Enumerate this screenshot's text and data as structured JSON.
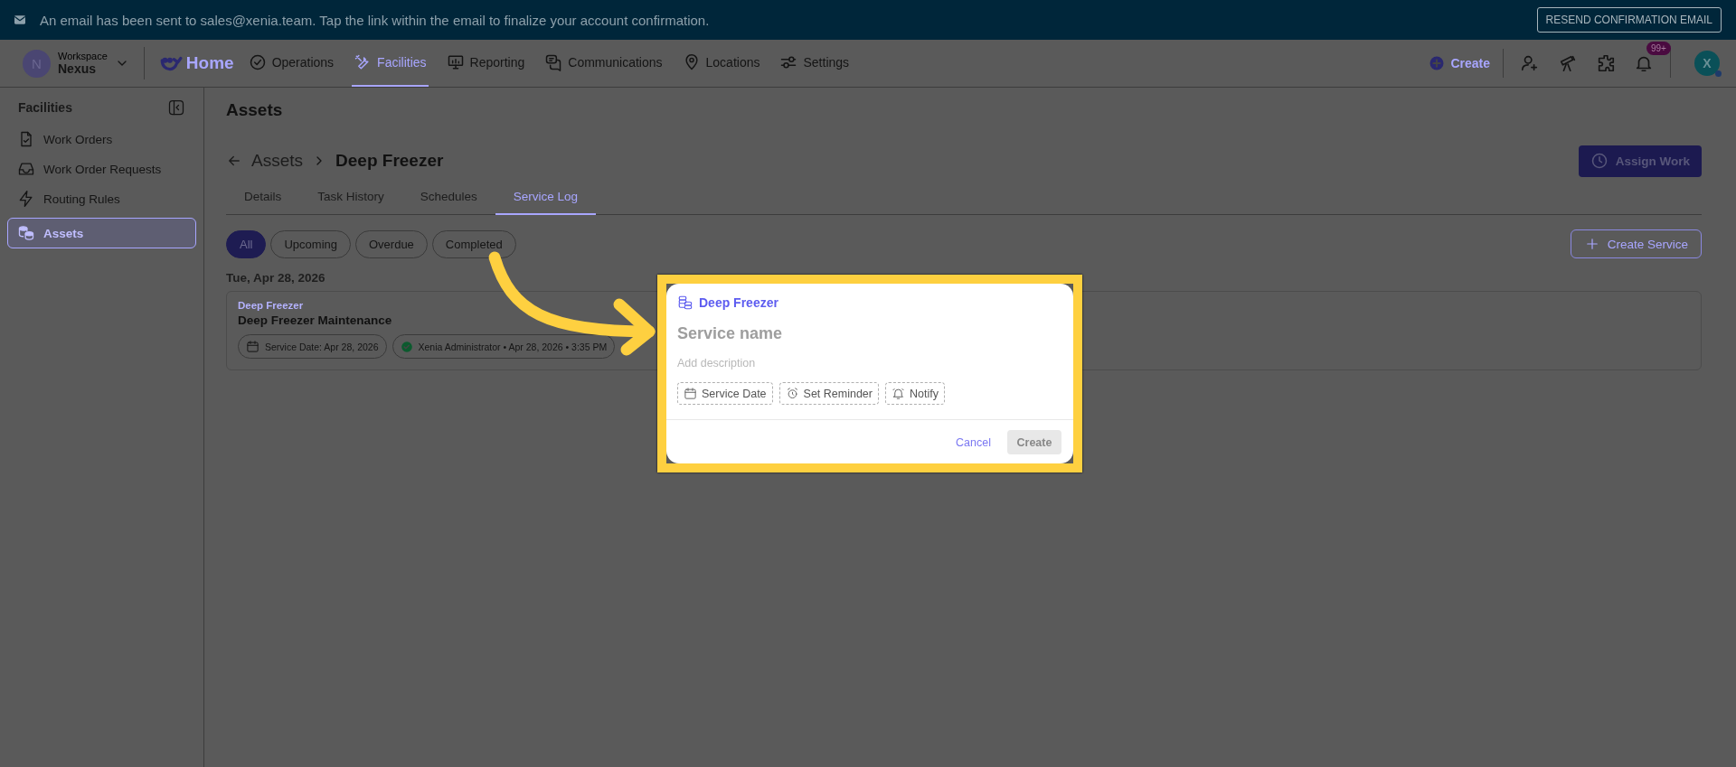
{
  "banner": {
    "message": "An email has been sent to sales@xenia.team. Tap the link within the email to finalize your account confirmation.",
    "action": "RESEND CONFIRMATION EMAIL"
  },
  "workspace": {
    "initial": "N",
    "label": "Workspace",
    "name": "Nexus"
  },
  "nav": {
    "home": "Home",
    "items": [
      {
        "label": "Operations",
        "selected": false
      },
      {
        "label": "Facilities",
        "selected": true
      },
      {
        "label": "Reporting",
        "selected": false
      },
      {
        "label": "Communications",
        "selected": false
      },
      {
        "label": "Locations",
        "selected": false
      },
      {
        "label": "Settings",
        "selected": false
      }
    ]
  },
  "header_actions": {
    "create": "Create",
    "notification_count": "99+",
    "avatar": "X"
  },
  "sidebar": {
    "title": "Facilities",
    "items": [
      {
        "label": "Work Orders",
        "selected": false
      },
      {
        "label": "Work Order Requests",
        "selected": false
      },
      {
        "label": "Routing Rules",
        "selected": false
      },
      {
        "label": "Assets",
        "selected": true
      }
    ]
  },
  "page": {
    "title": "Assets",
    "breadcrumb": {
      "parent": "Assets",
      "current": "Deep Freezer"
    },
    "assign_button": "Assign Work",
    "tabs": [
      {
        "label": "Details",
        "selected": false
      },
      {
        "label": "Task History",
        "selected": false
      },
      {
        "label": "Schedules",
        "selected": false
      },
      {
        "label": "Service Log",
        "selected": true
      }
    ],
    "filters": [
      {
        "label": "All",
        "selected": true
      },
      {
        "label": "Upcoming",
        "selected": false
      },
      {
        "label": "Overdue",
        "selected": false
      },
      {
        "label": "Completed",
        "selected": false
      }
    ],
    "create_service": "Create Service",
    "groups": [
      {
        "date": "Tue, Apr 28, 2026",
        "entries": [
          {
            "asset": "Deep Freezer",
            "title": "Deep Freezer Maintenance",
            "service_date": "Service Date: Apr 28, 2026",
            "completed": true,
            "completed_by": "Xenia Administrator",
            "separator": "•",
            "completed_at": "Apr 28, 2026 • 3:35 PM"
          }
        ]
      }
    ]
  },
  "dialog": {
    "asset": "Deep Freezer",
    "name_placeholder": "Service name",
    "description_placeholder": "Add description",
    "options": [
      "Service Date",
      "Set Reminder",
      "Notify"
    ],
    "cancel": "Cancel",
    "create": {
      "label": "Create",
      "disabled": true
    }
  }
}
